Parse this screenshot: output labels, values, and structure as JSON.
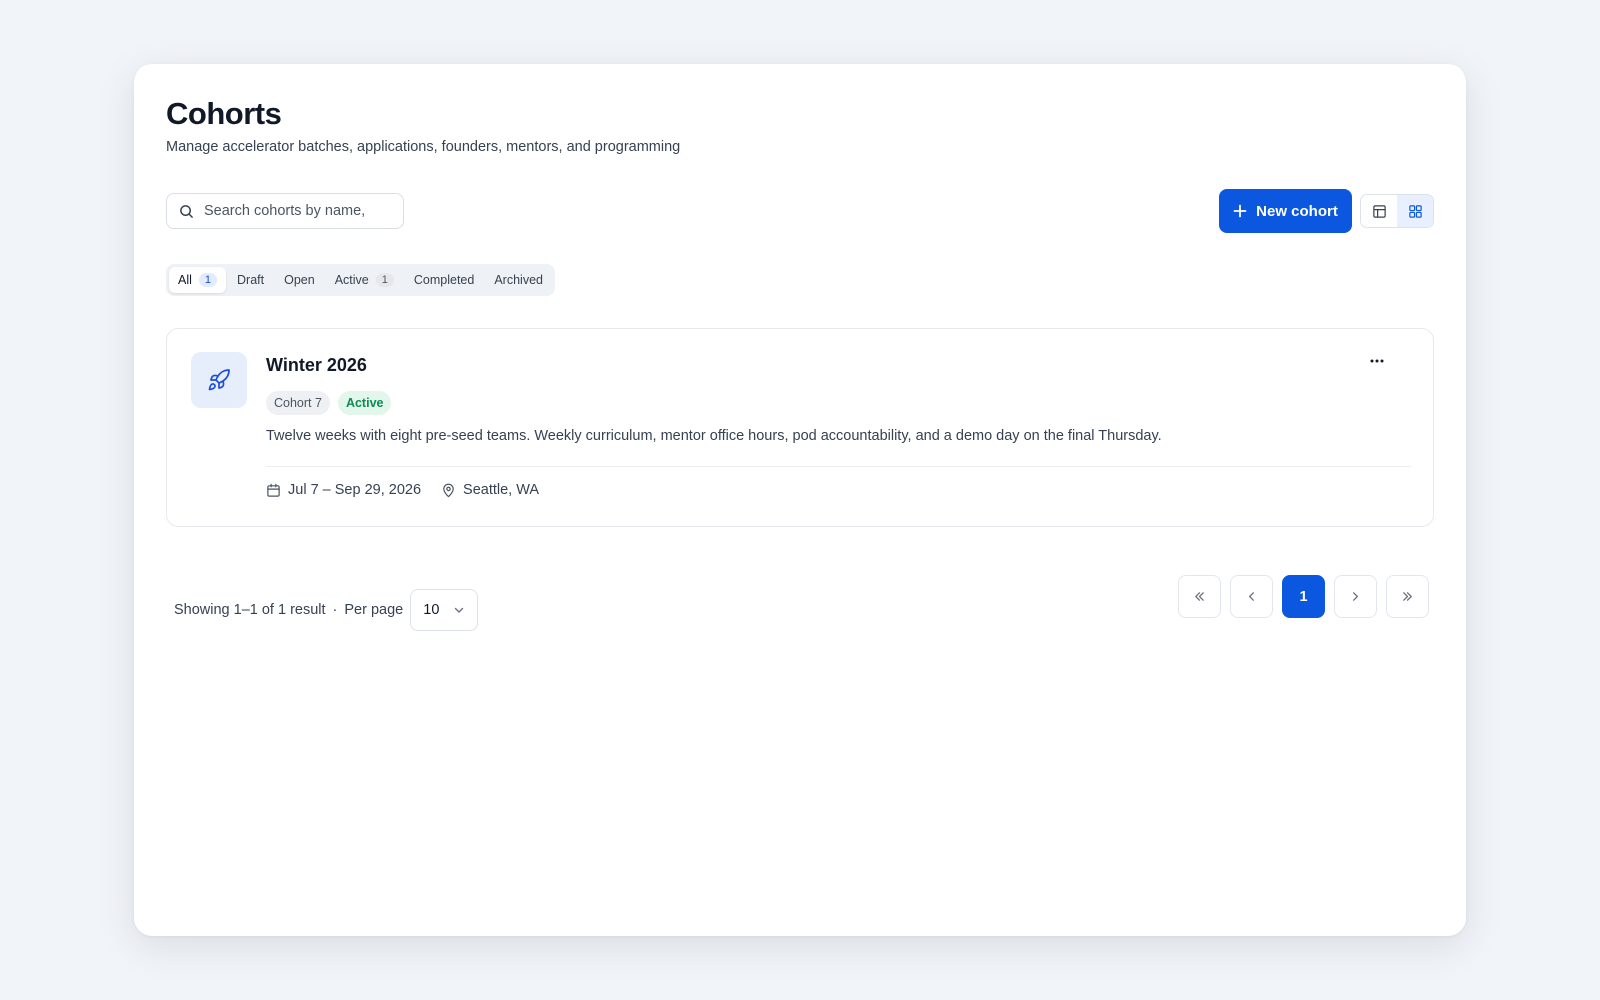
{
  "header": {
    "title": "Cohorts",
    "subtitle": "Manage accelerator batches, applications, founders, mentors, and programming"
  },
  "toolbar": {
    "search_placeholder": "Search cohorts by name,",
    "new_button_label": "New cohort",
    "view_toggle": {
      "options": [
        "table",
        "grid"
      ],
      "active": "grid"
    }
  },
  "tabs": [
    {
      "label": "All",
      "count": "1",
      "active": true
    },
    {
      "label": "Draft",
      "count": null
    },
    {
      "label": "Open",
      "count": null
    },
    {
      "label": "Active",
      "count": "1"
    },
    {
      "label": "Completed",
      "count": null
    },
    {
      "label": "Archived",
      "count": null
    }
  ],
  "cohorts": [
    {
      "name": "Winter 2026",
      "icon": "rocket-icon",
      "cohort_label": "Cohort 7",
      "status": "Active",
      "description": "Twelve weeks with eight pre-seed teams. Weekly curriculum, mentor office hours, pod accountability, and a demo day on the final Thursday.",
      "dates": "Jul 7 – Sep 29, 2026",
      "location": "Seattle, WA"
    }
  ],
  "footer": {
    "showing": "Showing 1–1 of 1 result",
    "separator": "·",
    "per_page_label": "Per page",
    "per_page_value": "10",
    "current_page": "1"
  },
  "colors": {
    "accent": "#0b57e0",
    "background": "#f1f4f8",
    "status_active_bg": "#e2f6ec",
    "status_active_text": "#0f8a55"
  }
}
